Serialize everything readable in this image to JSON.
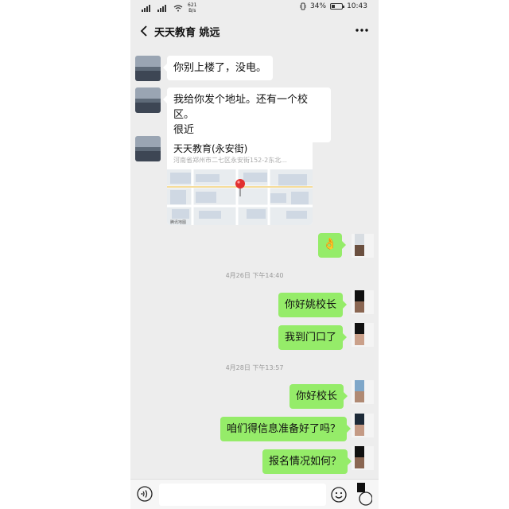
{
  "status": {
    "network_speed_value": "621",
    "network_speed_unit": "B/s",
    "battery_percent": "34%",
    "battery_level": 0.34,
    "time": "10:43"
  },
  "header": {
    "title": "天天教育 姚远",
    "back_icon": "chevron-left-icon",
    "more_icon": "ellipsis-icon"
  },
  "messages": [
    {
      "side": "left",
      "text": "你别上楼了，没电。"
    },
    {
      "side": "left",
      "text_line1": "我给你发个地址。还有一个校区。",
      "text_line2": "很近"
    },
    {
      "side": "left",
      "type": "location",
      "name": "天天教育(永安街)",
      "address": "河南省郑州市二七区永安街152-2东北..."
    },
    {
      "side": "right",
      "type": "emoji",
      "icon": "ok-hand-icon",
      "glyph": "👌"
    },
    {
      "timestamp": "4月26日 下午14:40"
    },
    {
      "side": "right",
      "text": "你好姚校长"
    },
    {
      "side": "right",
      "text": "我到门口了"
    },
    {
      "timestamp": "4月28日 下午13:57"
    },
    {
      "side": "right",
      "text": "你好校长"
    },
    {
      "side": "right",
      "text": "咱们得信息准备好了吗？"
    },
    {
      "side": "right",
      "text": "报名情况如何？"
    }
  ],
  "input_bar": {
    "voice_icon": "voice-icon",
    "emoji_icon": "emoji-icon",
    "value": ""
  },
  "colors": {
    "chat_background": "#ededed",
    "sent_bubble": "#95ec69",
    "received_bubble": "#ffffff"
  }
}
